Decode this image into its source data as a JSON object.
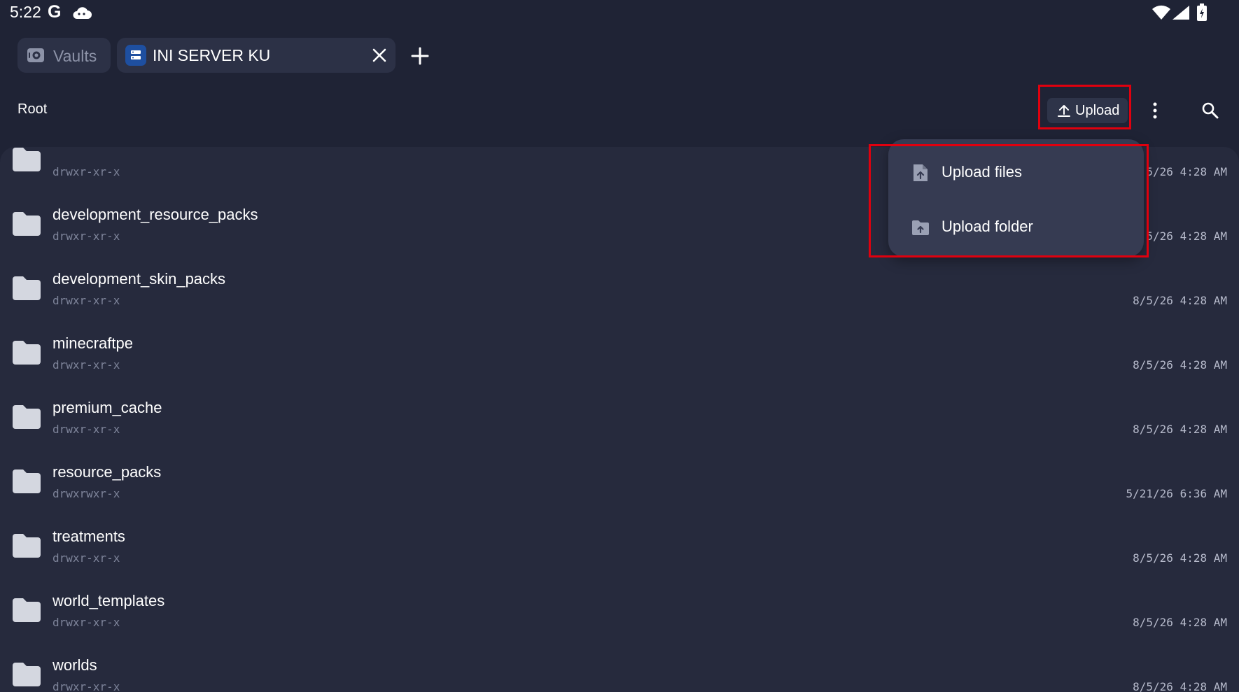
{
  "status_bar": {
    "time": "5:22",
    "google_glyph": "G",
    "icons": [
      "google-icon",
      "cloud-icon",
      "wifi-icon",
      "signal-icon",
      "battery-icon"
    ]
  },
  "tabs": [
    {
      "label": "Vaults",
      "icon": "vault-icon",
      "active": false
    },
    {
      "label": "INI SERVER KU",
      "icon": "server-icon",
      "active": true
    }
  ],
  "toolbar": {
    "breadcrumb": "Root",
    "upload_label": "Upload"
  },
  "upload_menu": {
    "items": [
      {
        "label": "Upload files",
        "icon": "upload-file-icon"
      },
      {
        "label": "Upload folder",
        "icon": "upload-folder-icon"
      }
    ]
  },
  "files": [
    {
      "name": "",
      "perm": "drwxr-xr-x",
      "date": "5/26 4:28 AM"
    },
    {
      "name": "development_resource_packs",
      "perm": "drwxr-xr-x",
      "date": "5/26 4:28 AM"
    },
    {
      "name": "development_skin_packs",
      "perm": "drwxr-xr-x",
      "date": "8/5/26 4:28 AM"
    },
    {
      "name": "minecraftpe",
      "perm": "drwxr-xr-x",
      "date": "8/5/26 4:28 AM"
    },
    {
      "name": "premium_cache",
      "perm": "drwxr-xr-x",
      "date": "8/5/26 4:28 AM"
    },
    {
      "name": "resource_packs",
      "perm": "drwxrwxr-x",
      "date": "5/21/26 6:36 AM"
    },
    {
      "name": "treatments",
      "perm": "drwxr-xr-x",
      "date": "8/5/26 4:28 AM"
    },
    {
      "name": "world_templates",
      "perm": "drwxr-xr-x",
      "date": "8/5/26 4:28 AM"
    },
    {
      "name": "worlds",
      "perm": "drwxr-xr-x",
      "date": "8/5/26 4:28 AM"
    }
  ],
  "colors": {
    "background": "#1f2335",
    "list_background": "#262a3d",
    "menu_background": "#363b52",
    "highlight": "#e0000e",
    "folder": "#d4d7e0",
    "server_badge": "#1e4fa0"
  }
}
